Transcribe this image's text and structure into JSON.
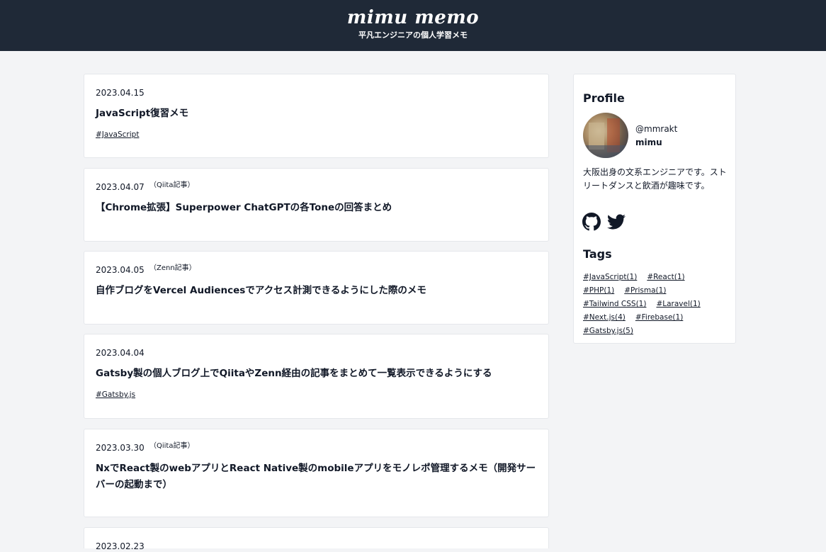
{
  "header": {
    "title": "mimu memo",
    "subtitle": "平凡エンジニアの個人学習メモ"
  },
  "posts": [
    {
      "date": "2023.04.15",
      "source": "",
      "title": "JavaScript復習メモ",
      "tag": "#JavaScript"
    },
    {
      "date": "2023.04.07",
      "source": "（Qiita記事）",
      "title": "【Chrome拡張】Superpower ChatGPTの各Toneの回答まとめ",
      "tag": ""
    },
    {
      "date": "2023.04.05",
      "source": "（Zenn記事）",
      "title": "自作ブログをVercel Audiencesでアクセス計測できるようにした際のメモ",
      "tag": ""
    },
    {
      "date": "2023.04.04",
      "source": "",
      "title": "Gatsby製の個人ブログ上でQiitaやZenn経由の記事をまとめて一覧表示できるようにする",
      "tag": "#Gatsby.js"
    },
    {
      "date": "2023.03.30",
      "source": "（Qiita記事）",
      "title_line1": "NxでReact製のwebアプリとReact Native製のmobileアプリをモノレポ管理するメモ（開発サー",
      "title_line2": "バーの起動まで）",
      "tag": ""
    },
    {
      "date": "2023.02.23",
      "source": "",
      "title": "",
      "tag": ""
    }
  ],
  "sidebar": {
    "profile_heading": "Profile",
    "handle": "@mmrakt",
    "name": "mimu",
    "bio": "大阪出身の文系エンジニアです。ストリートダンスと飲酒が趣味です。",
    "social": [
      "github-icon",
      "twitter-icon"
    ],
    "tags_heading": "Tags",
    "tags": [
      [
        "#JavaScript(1)",
        "#React(1)"
      ],
      [
        "#PHP(1)",
        "#Prisma(1)"
      ],
      [
        "#Tailwind CSS(1)",
        "#Laravel(1)"
      ],
      [
        "#Next.js(4)",
        "#Firebase(1)"
      ],
      [
        "#Gatsby.js(5)"
      ]
    ]
  },
  "colors": {
    "header_bg": "#1f2937",
    "page_bg": "#f3f4f6",
    "card_bg": "#ffffff",
    "text": "#111827"
  }
}
